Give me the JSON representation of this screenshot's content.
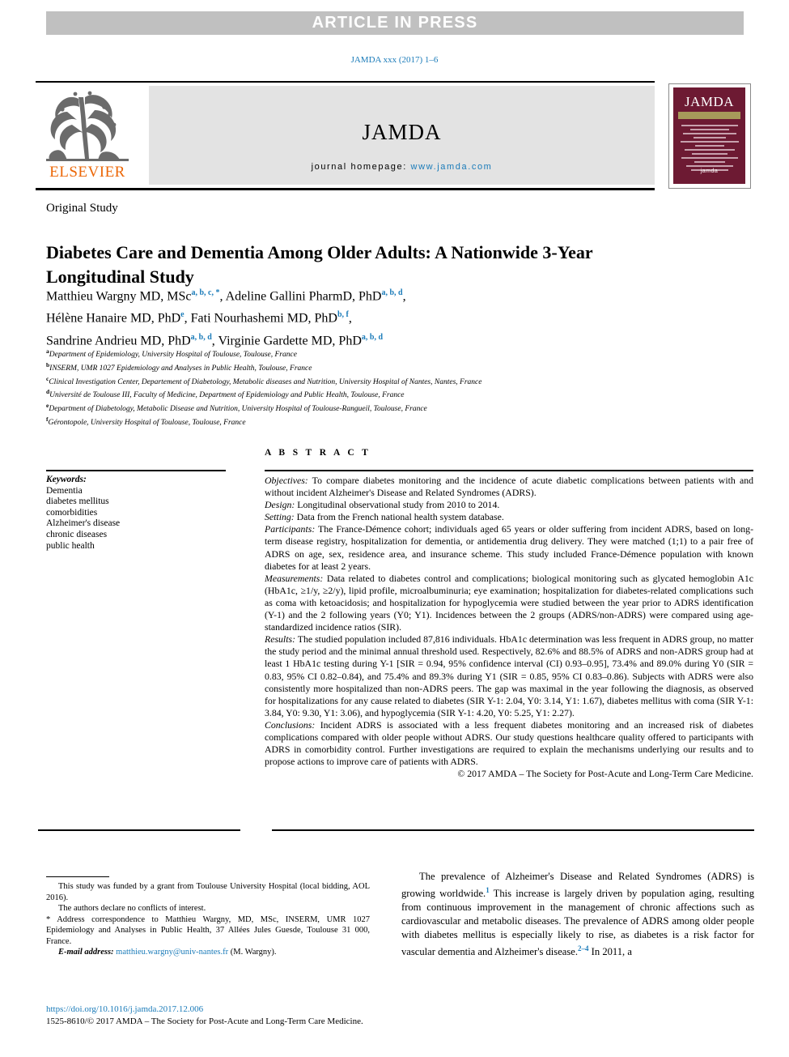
{
  "banner": {
    "text": "ARTICLE IN PRESS"
  },
  "running_head": {
    "text": "JAMDA xxx (2017) 1–6"
  },
  "masthead": {
    "publisher": "ELSEVIER",
    "journal_name": "JAMDA",
    "homepage_label": "journal homepage:",
    "homepage_url": "www.jamda.com",
    "cover": {
      "title": "JAMDA",
      "logo": "jamda"
    },
    "colors": {
      "elsevier_orange": "#ec6707",
      "link_blue": "#1a7bb9",
      "cover_maroon": "#6d1a33",
      "cover_band": "#a79a5a",
      "banner_gray": "#c0c0c0"
    }
  },
  "article": {
    "type": "Original Study",
    "title": "Diabetes Care and Dementia Among Older Adults: A Nationwide 3-Year Longitudinal Study",
    "authors": [
      {
        "name": "Matthieu Wargny MD, MSc",
        "marks": "a, b, c, *"
      },
      {
        "name": "Adeline Gallini PharmD, PhD",
        "marks": "a, b, d"
      },
      {
        "name": "Hélène Hanaire MD, PhD",
        "marks": "e"
      },
      {
        "name": "Fati Nourhashemi MD, PhD",
        "marks": "b, f"
      },
      {
        "name": "Sandrine Andrieu MD, PhD",
        "marks": "a, b, d"
      },
      {
        "name": "Virginie Gardette MD, PhD",
        "marks": "a, b, d"
      }
    ],
    "affiliations": [
      {
        "mark": "a",
        "text": "Department of Epidemiology, University Hospital of Toulouse, Toulouse, France"
      },
      {
        "mark": "b",
        "text": "INSERM, UMR 1027 Epidemiology and Analyses in Public Health, Toulouse, France"
      },
      {
        "mark": "c",
        "text": "Clinical Investigation Center, Departement of Diabetology, Metabolic diseases and Nutrition, University Hospital of Nantes, Nantes, France"
      },
      {
        "mark": "d",
        "text": "Université de Toulouse III, Faculty of Medicine, Department of Epidemiology and Public Health, Toulouse, France"
      },
      {
        "mark": "e",
        "text": "Department of Diabetology, Metabolic Disease and Nutrition, University Hospital of Toulouse-Rangueil, Toulouse, France"
      },
      {
        "mark": "f",
        "text": "Gérontopole, University Hospital of Toulouse, Toulouse, France"
      }
    ]
  },
  "keywords": {
    "heading": "Keywords:",
    "items": [
      "Dementia",
      "diabetes mellitus",
      "comorbidities",
      "Alzheimer's disease",
      "chronic diseases",
      "public health"
    ]
  },
  "abstract": {
    "heading": "A B S T R A C T",
    "sections": [
      {
        "label": "Objectives:",
        "text": " To compare diabetes monitoring and the incidence of acute diabetic complications between patients with and without incident Alzheimer's Disease and Related Syndromes (ADRS)."
      },
      {
        "label": "Design:",
        "text": " Longitudinal observational study from 2010 to 2014."
      },
      {
        "label": "Setting:",
        "text": " Data from the French national health system database."
      },
      {
        "label": "Participants:",
        "text": " The France-Démence cohort; individuals aged 65 years or older suffering from incident ADRS, based on long-term disease registry, hospitalization for dementia, or antidementia drug delivery. They were matched (1;1) to a pair free of ADRS on age, sex, residence area, and insurance scheme. This study included France-Démence population with known diabetes for at least 2 years."
      },
      {
        "label": "Measurements:",
        "text": " Data related to diabetes control and complications; biological monitoring such as glycated hemoglobin A1c (HbA1c, ≥1/y, ≥2/y), lipid profile, microalbuminuria; eye examination; hospitalization for diabetes-related complications such as coma with ketoacidosis; and hospitalization for hypoglycemia were studied between the year prior to ADRS identification (Y-1) and the 2 following years (Y0; Y1). Incidences between the 2 groups (ADRS/non-ADRS) were compared using age-standardized incidence ratios (SIR)."
      },
      {
        "label": "Results:",
        "text": " The studied population included 87,816 individuals. HbA1c determination was less frequent in ADRS group, no matter the study period and the minimal annual threshold used. Respectively, 82.6% and 88.5% of ADRS and non-ADRS group had at least 1 HbA1c testing during Y-1 [SIR = 0.94, 95% confidence interval (CI) 0.93–0.95], 73.4% and 89.0% during Y0 (SIR = 0.83, 95% CI 0.82–0.84), and 75.4% and 89.3% during Y1 (SIR = 0.85, 95% CI 0.83–0.86). Subjects with ADRS were also consistently more hospitalized than non-ADRS peers. The gap was maximal in the year following the diagnosis, as observed for hospitalizations for any cause related to diabetes (SIR Y-1: 2.04, Y0: 3.14, Y1: 1.67), diabetes mellitus with coma (SIR Y-1: 3.84, Y0: 9.30, Y1: 3.06), and hypoglycemia (SIR Y-1: 4.20, Y0: 5.25, Y1: 2.27)."
      },
      {
        "label": "Conclusions:",
        "text": " Incident ADRS is associated with a less frequent diabetes monitoring and an increased risk of diabetes complications compared with older people without ADRS. Our study questions healthcare quality offered to participants with ADRS in comorbidity control. Further investigations are required to explain the mechanisms underlying our results and to propose actions to improve care of patients with ADRS."
      }
    ],
    "copyright": "© 2017 AMDA – The Society for Post-Acute and Long-Term Care Medicine."
  },
  "footnotes": {
    "funding": "This study was funded by a grant from Toulouse University Hospital (local bidding, AOL 2016).",
    "conflicts": "The authors declare no conflicts of interest.",
    "correspondence_mark": "*",
    "correspondence": "Address correspondence to Matthieu Wargny, MD, MSc, INSERM, UMR 1027 Epidemiology and Analyses in Public Health, 37 Allées Jules Guesde, Toulouse 31 000, France.",
    "email_label": "E-mail address:",
    "email": "matthieu.wargny@univ-nantes.fr",
    "email_suffix": " (M. Wargny)."
  },
  "publication": {
    "doi": "https://doi.org/10.1016/j.jamda.2017.12.006",
    "issn_line": "1525-8610/© 2017 AMDA – The Society for Post-Acute and Long-Term Care Medicine."
  },
  "body": {
    "paragraph_1": {
      "part1": "The prevalence of Alzheimer's Disease and Related Syndromes (ADRS) is growing worldwide.",
      "ref1": "1",
      "part2": " This increase is largely driven by population aging, resulting from continuous improvement in the management of chronic affections such as cardiovascular and metabolic diseases. The prevalence of ADRS among older people with diabetes mellitus is especially likely to rise, as diabetes is a risk factor for vascular dementia and Alzheimer's disease.",
      "ref2": "2–4",
      "part3": " In 2011, a"
    }
  }
}
